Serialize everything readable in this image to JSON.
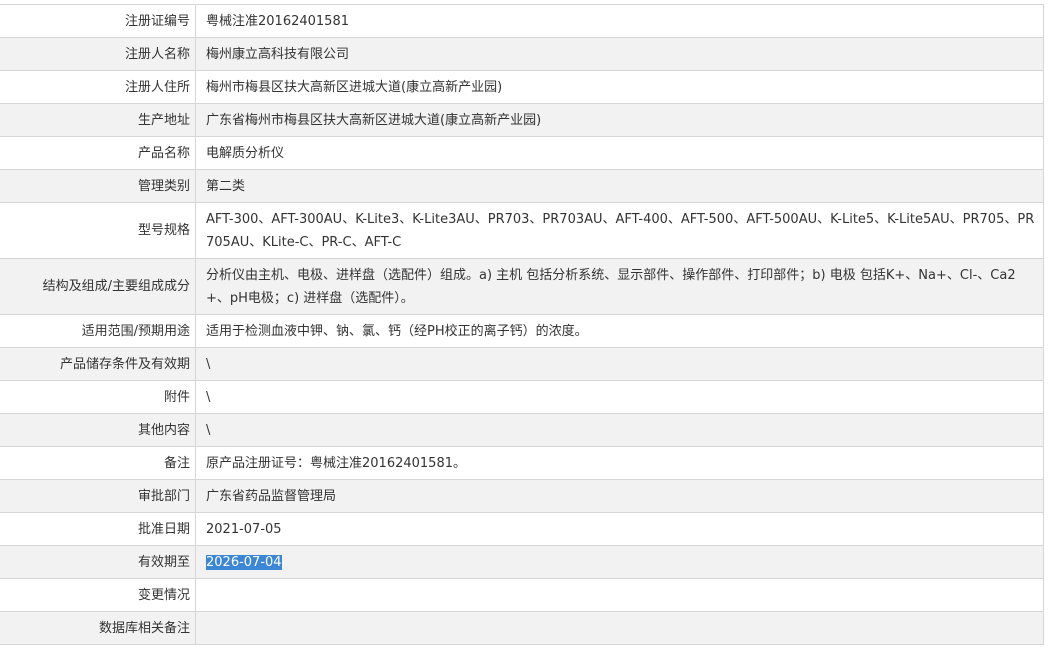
{
  "record": {
    "rows": [
      {
        "label": "注册证编号",
        "value": "粤械注准20162401581"
      },
      {
        "label": "注册人名称",
        "value": "梅州康立高科技有限公司"
      },
      {
        "label": "注册人住所",
        "value": "梅州市梅县区扶大高新区进城大道(康立高新产业园)"
      },
      {
        "label": "生产地址",
        "value": "广东省梅州市梅县区扶大高新区进城大道(康立高新产业园)"
      },
      {
        "label": "产品名称",
        "value": "电解质分析仪"
      },
      {
        "label": "管理类别",
        "value": "第二类"
      },
      {
        "label": "型号规格",
        "value": "AFT-300、AFT-300AU、K-Lite3、K-Lite3AU、PR703、PR703AU、AFT-400、AFT-500、AFT-500AU、K-Lite5、K-Lite5AU、PR705、PR705AU、KLite-C、PR-C、AFT-C"
      },
      {
        "label": "结构及组成/主要组成成分",
        "value": "分析仪由主机、电极、进样盘（选配件）组成。a) 主机 包括分析系统、显示部件、操作部件、打印部件；b) 电极 包括K+、Na+、Cl-、Ca2+、pH电极；c) 进样盘（选配件）。"
      },
      {
        "label": "适用范围/预期用途",
        "value": "适用于检测血液中钾、钠、氯、钙（经PH校正的离子钙）的浓度。"
      },
      {
        "label": "产品储存条件及有效期",
        "value": "\\"
      },
      {
        "label": "附件",
        "value": "\\"
      },
      {
        "label": "其他内容",
        "value": "\\"
      },
      {
        "label": "备注",
        "value": "原产品注册证号：粤械注准20162401581。"
      },
      {
        "label": "审批部门",
        "value": "广东省药品监督管理局"
      },
      {
        "label": "批准日期",
        "value": "2021-07-05"
      },
      {
        "label": "有效期至",
        "value": "2026-07-04"
      },
      {
        "label": "变更情况",
        "value": ""
      },
      {
        "label": "数据库相关备注",
        "value": ""
      }
    ]
  },
  "colors": {
    "border": "#d6d6d6",
    "alt_row": "#f2f2f2",
    "text": "#333333",
    "selection": "#3b87d6"
  }
}
